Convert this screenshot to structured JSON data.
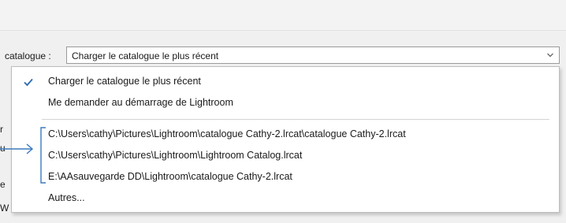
{
  "settings": {
    "catalogue_label": "catalogue :",
    "selected_value": "Charger le catalogue le plus récent"
  },
  "dropdown": {
    "items": [
      {
        "label": "Charger le catalogue le plus récent",
        "checked": true
      },
      {
        "label": "Me demander au démarrage de Lightroom",
        "checked": false
      },
      {
        "label": "C:\\Users\\cathy\\Pictures\\Lightroom\\catalogue Cathy-2.lrcat\\catalogue Cathy-2.lrcat",
        "checked": false
      },
      {
        "label": "C:\\Users\\cathy\\Pictures\\Lightroom\\Lightroom Catalog.lrcat",
        "checked": false
      },
      {
        "label": "E:\\AAsauvegarde DD\\Lightroom\\catalogue Cathy-2.lrcat",
        "checked": false
      },
      {
        "label": "Autres...",
        "checked": false
      }
    ]
  },
  "colors": {
    "check": "#2b6cb0",
    "annotation": "#3a7abf"
  },
  "icons": {
    "dropdown": "chevron-down-icon",
    "selected": "check-icon",
    "annotation": "arrow-right-icon"
  }
}
